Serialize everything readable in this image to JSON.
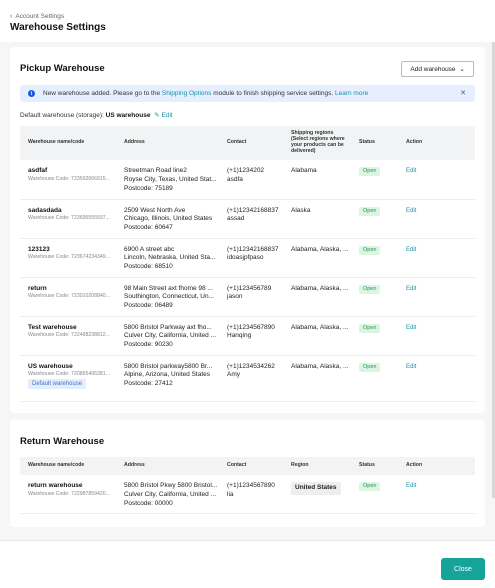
{
  "header": {
    "back_label": "Account Settings",
    "title": "Warehouse Settings"
  },
  "pickup": {
    "title": "Pickup Warehouse",
    "add_button": "Add warehouse",
    "notice_prefix": "New warehouse added. Please go to the ",
    "notice_link": "Shipping Options",
    "notice_mid": " module to finish shipping service settings. ",
    "notice_learn": "Learn more",
    "default_label": "Default warehouse (storage):",
    "default_name": "US warehouse",
    "default_edit": "Edit",
    "columns": [
      "Warehouse name/code",
      "Address",
      "Contact",
      "Shipping regions (Select regions where your products can be delivered)",
      "Status",
      "Action"
    ],
    "rows": [
      {
        "name": "asdfaf",
        "code": "Warehouse Code: 723502666915...",
        "addr1": "Streetman Road line2",
        "addr2": "Royse City, Texas, United Stat...",
        "postcode": "Postcode: 75189",
        "phone": "(+1)1234202",
        "person": "asdfa",
        "regions": "Alabama",
        "status": "Open",
        "action": "Edit",
        "badge": ""
      },
      {
        "name": "sadasdada",
        "code": "Warehouse Code: 723695555597...",
        "addr1": "2509 West North Ave",
        "addr2": "Chicago, Illinois, United States",
        "postcode": "Postcode: 60647",
        "phone": "(+1)12342168837",
        "person": "assad",
        "regions": "Alaska",
        "status": "Open",
        "action": "Edit",
        "badge": ""
      },
      {
        "name": "123123",
        "code": "Warehouse Code: 723674234349...",
        "addr1": "6900 A street abc",
        "addr2": "Lincoln, Nebraska, United Sta...",
        "postcode": "Postcode: 68510",
        "phone": "(+1)12342168837",
        "person": "idoasjpfpaso",
        "regions": "Alabama, Alaska, ...",
        "status": "Open",
        "action": "Edit",
        "badge": ""
      },
      {
        "name": "return",
        "code": "Warehouse Code: 723010208840...",
        "addr1": "98 Main Street axt fhome 98 ...",
        "addr2": "Southington, Connecticut, Un...",
        "postcode": "Postcode: 06489",
        "phone": "(+1)123456789",
        "person": "jason",
        "regions": "Alabama, Alaska, ...",
        "status": "Open",
        "action": "Edit",
        "badge": ""
      },
      {
        "name": "Test warehouse",
        "code": "Warehouse Code: 722488238812...",
        "addr1": "5800 Bristol Parkway axt fho...",
        "addr2": "Culver City, California, United ...",
        "postcode": "Postcode: 90230",
        "phone": "(+1)1234567890",
        "person": "Hanqing",
        "regions": "Alabama, Alaska, ...",
        "status": "Open",
        "action": "Edit",
        "badge": ""
      },
      {
        "name": "US warehouse",
        "code": "Warehouse Code: 720865406381...",
        "addr1": "5800 Bristol parkway5800 Br...",
        "addr2": "Alpine, Arizona, United States",
        "postcode": "Postcode: 27412",
        "phone": "(+1)1234534262",
        "person": "Amy",
        "regions": "Alabama, Alaska, ...",
        "status": "Open",
        "action": "Edit",
        "badge": "Default warehouse"
      }
    ]
  },
  "return_wh": {
    "title": "Return Warehouse",
    "columns": [
      "Warehouse name/code",
      "Address",
      "Contact",
      "Region",
      "Status",
      "Action"
    ],
    "rows": [
      {
        "name": "return warehouse",
        "code": "Warehouse Code: 722987859420...",
        "addr1": "5800 Bristol Pkwy 5800 Bristol...",
        "addr2": "Culver City, California, United ...",
        "postcode": "Postcode: 00000",
        "phone": "(+1)1234567890",
        "person": "lia",
        "region": "United States",
        "status": "Open",
        "action": "Edit"
      }
    ]
  },
  "footer": {
    "close_label": "Close"
  },
  "colors": {
    "accent": "#16a39a",
    "link": "#1c8fa0",
    "status_bg": "#dcf5e3",
    "status_fg": "#1d9a52",
    "notice_bg": "#e6efff"
  }
}
